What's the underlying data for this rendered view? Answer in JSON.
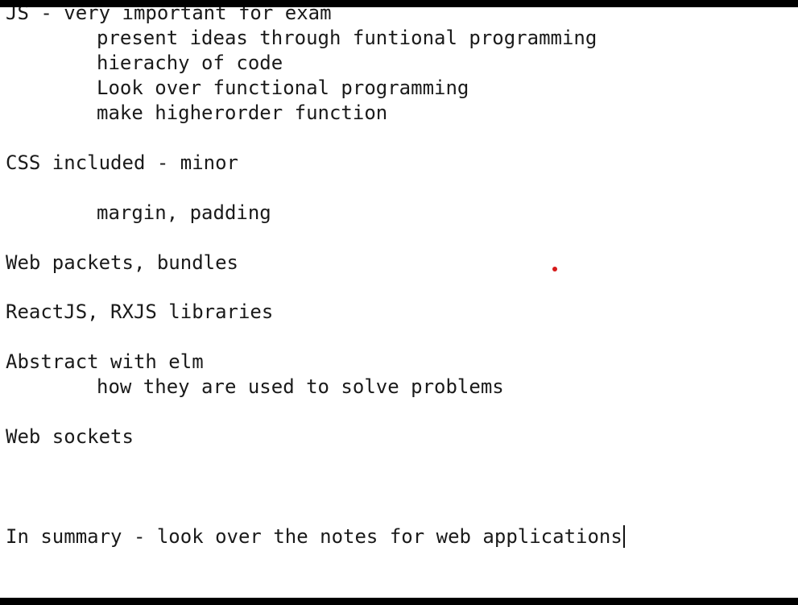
{
  "document": {
    "lines": [
      "JS - very important for exam",
      "present ideas through funtional programming",
      "hierachy of code",
      "Look over functional programming",
      "make higherorder function",
      "CSS included - minor",
      "margin, padding",
      "Web packets, bundles",
      "ReactJS, RXJS libraries",
      "Abstract with elm",
      "how they are used to solve problems",
      "Web sockets",
      "In summary - look over the notes for web applications"
    ]
  },
  "colors": {
    "text": "#1a1a1a",
    "page": "#ffffff",
    "frame": "#000000",
    "marker": "#d61a1a"
  }
}
